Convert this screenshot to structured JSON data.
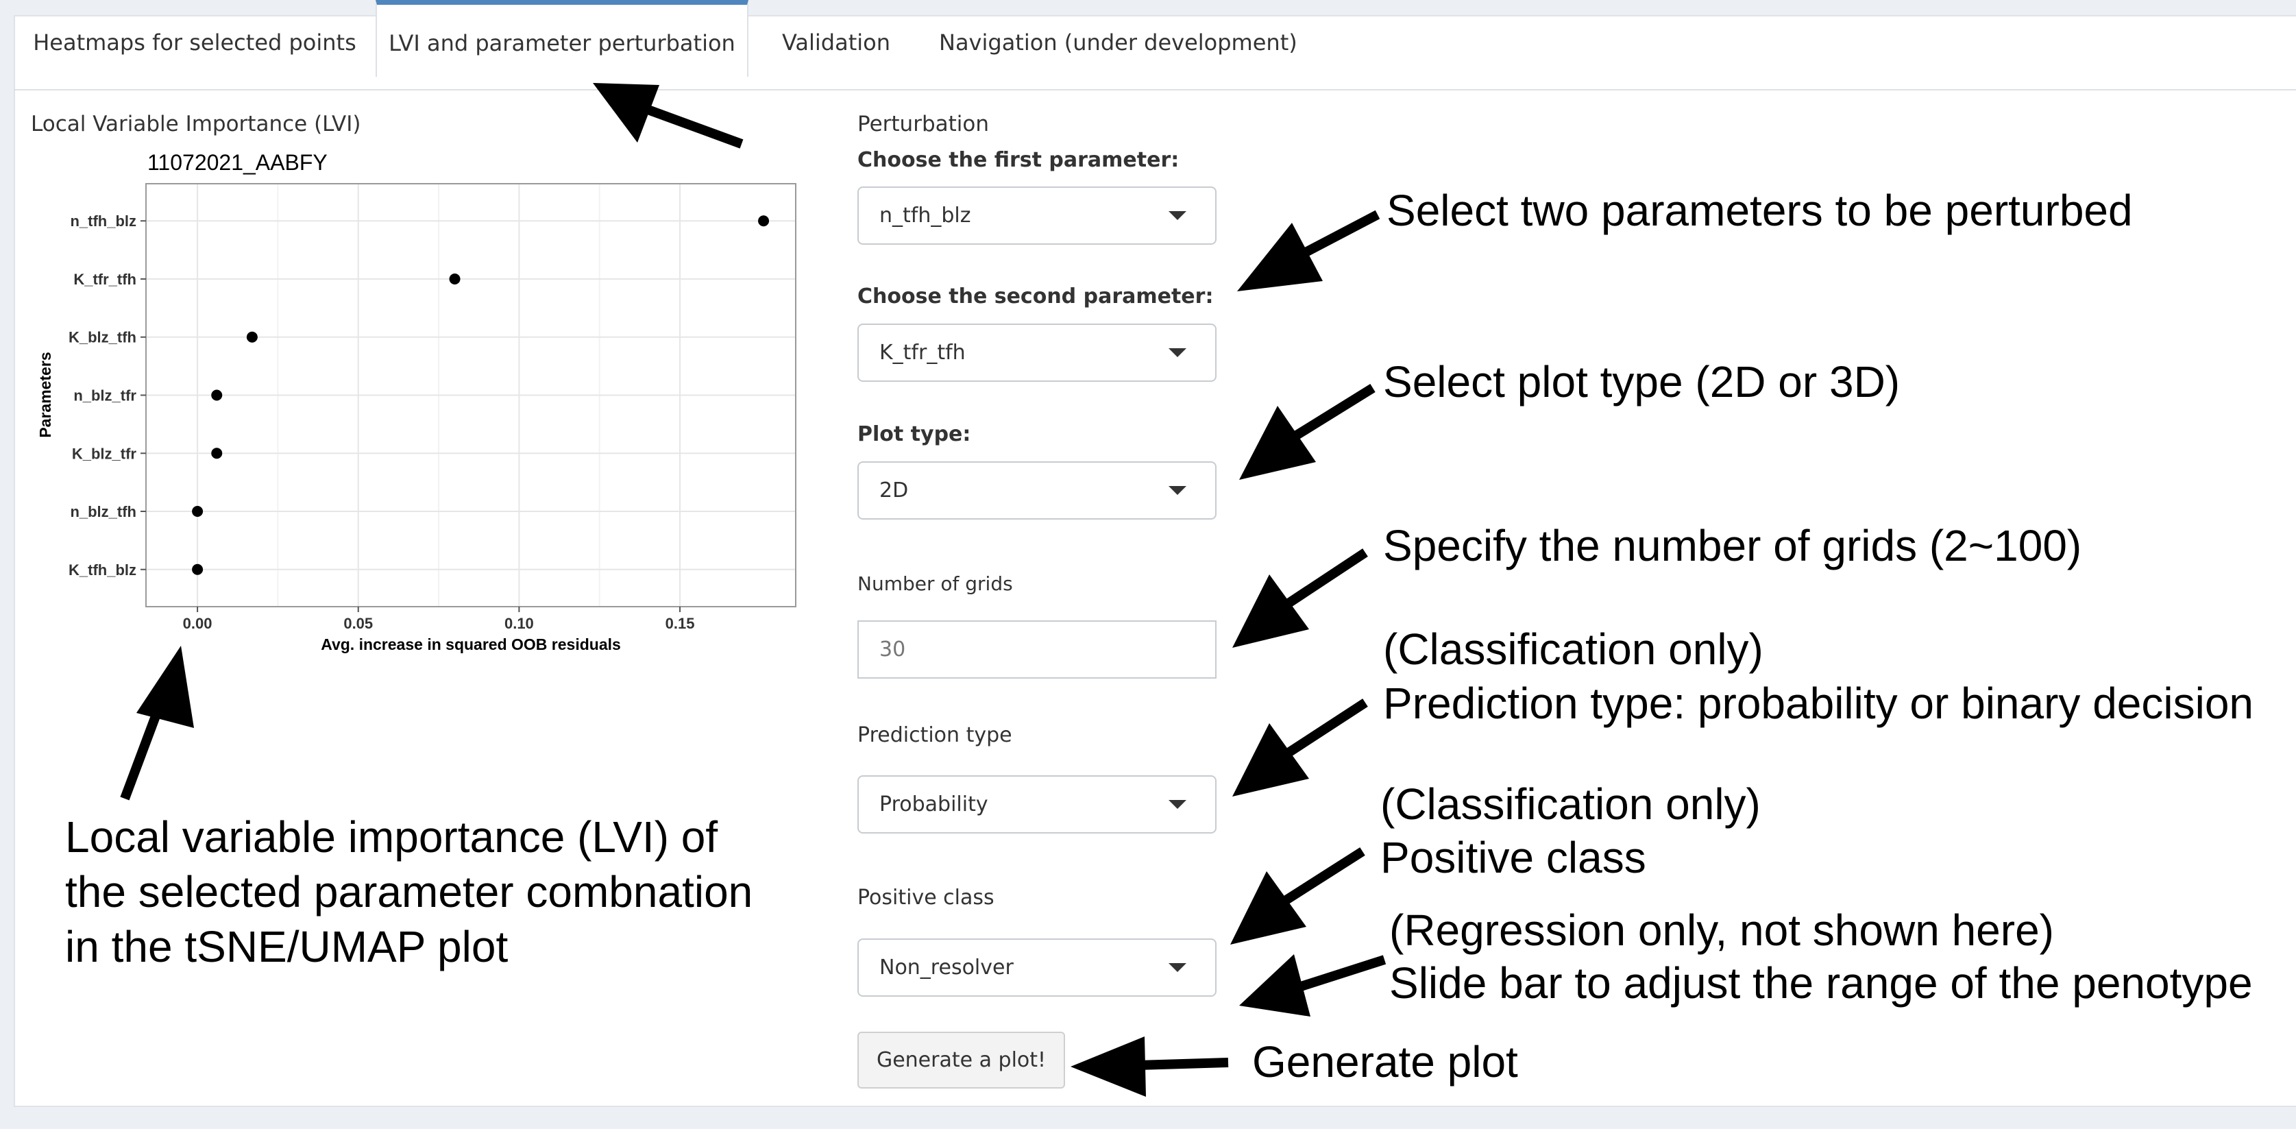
{
  "tabs": [
    {
      "label": "Heatmaps for selected points"
    },
    {
      "label": "LVI and parameter perturbation"
    },
    {
      "label": "Validation"
    },
    {
      "label": "Navigation (under development)"
    }
  ],
  "lvi": {
    "section_title": "Local Variable Importance (LVI)"
  },
  "chart_data": {
    "type": "scatter",
    "title": "11072021_AABFY",
    "xlabel": "Avg. increase in squared OOB residuals",
    "ylabel": "Parameters",
    "categories": [
      "n_tfh_blz",
      "K_tfr_tfh",
      "K_blz_tfh",
      "n_blz_tfr",
      "K_blz_tfr",
      "n_blz_tfh",
      "K_tfh_blz"
    ],
    "values": [
      0.176,
      0.08,
      0.017,
      0.006,
      0.006,
      0.0,
      0.0
    ],
    "xlim": [
      -0.016,
      0.186
    ],
    "xticks": [
      0.0,
      0.05,
      0.1,
      0.15
    ],
    "xtick_labels": [
      "0.00",
      "0.05",
      "0.10",
      "0.15"
    ],
    "grid": true
  },
  "perturbation": {
    "section_title": "Perturbation",
    "first_param_label": "Choose the first parameter:",
    "first_param_value": "n_tfh_blz",
    "second_param_label": "Choose the second parameter:",
    "second_param_value": "K_tfr_tfh",
    "plot_type_label": "Plot type:",
    "plot_type_value": "2D",
    "grids_label": "Number of grids",
    "grids_value": "30",
    "prediction_type_label": "Prediction type",
    "prediction_type_value": "Probability",
    "positive_class_label": "Positive class",
    "positive_class_value": "Non_resolver",
    "generate_label": "Generate a plot!"
  },
  "annotations": {
    "select_params": "Select two parameters to be perturbed",
    "plot_type": "Select plot type (2D or 3D)",
    "grids": "Specify the number of grids (2~100)",
    "pred_line1": "(Classification only)",
    "pred_line2": "Prediction type: probability or binary decision",
    "pos_line1": "(Classification only)",
    "pos_line2": "Positive class",
    "reg_line1": "(Regression only, not shown here)",
    "reg_line2": "Slide bar to adjust the range of the penotype",
    "generate": "Generate plot",
    "lvi_line1": "Local variable importance (LVI) of",
    "lvi_line2": "the selected parameter combnation",
    "lvi_line3": "in the tSNE/UMAP plot"
  }
}
